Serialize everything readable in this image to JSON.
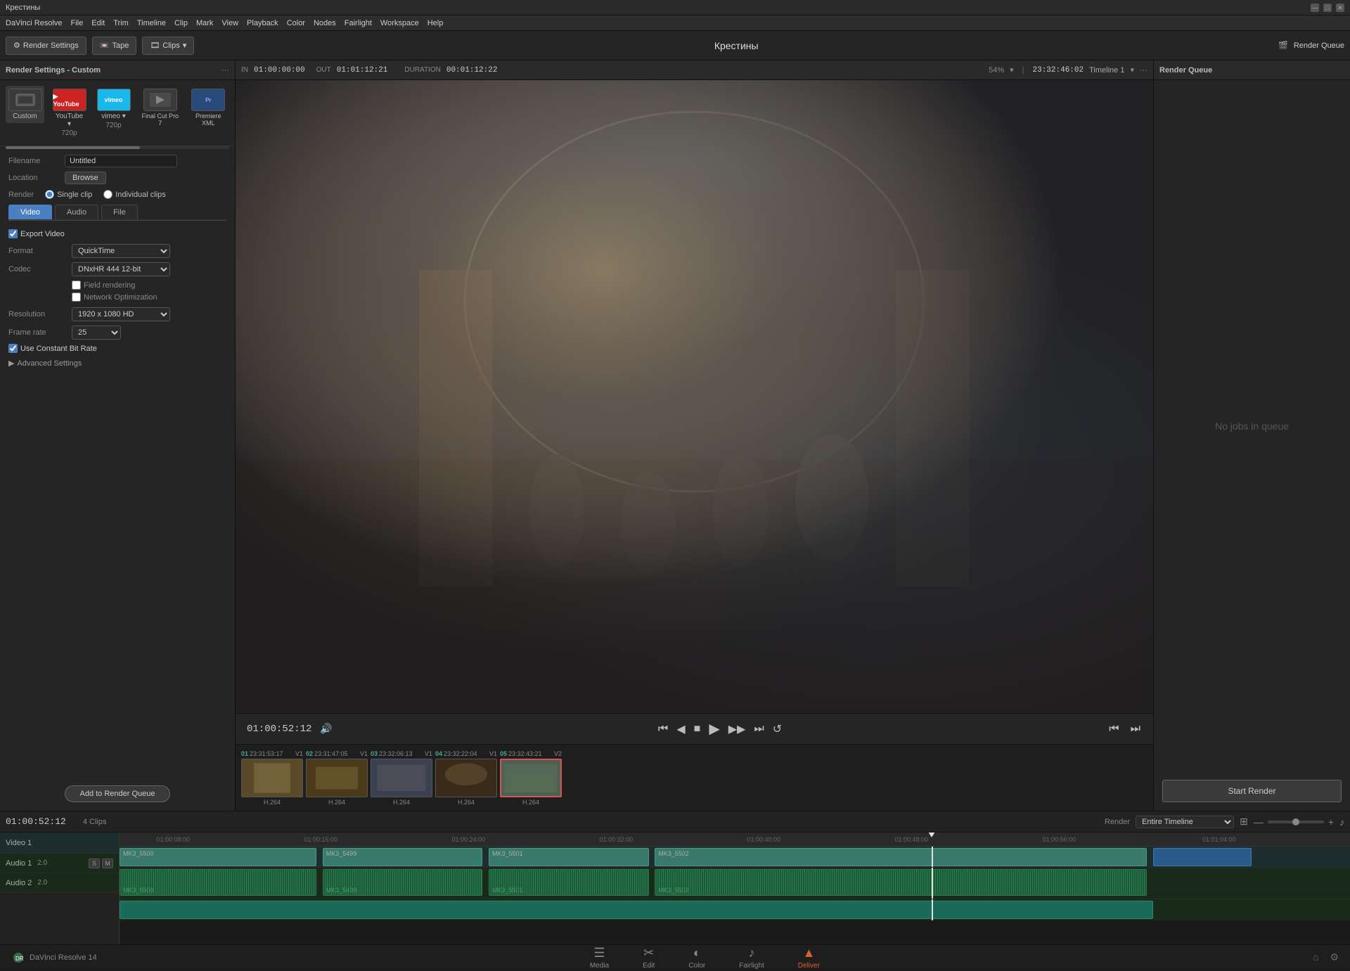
{
  "window": {
    "title": "Крестины",
    "app": "DaVinci Resolve"
  },
  "titlebar": {
    "title": "Крестины",
    "minimize": "—",
    "maximize": "□",
    "close": "✕"
  },
  "menubar": {
    "items": [
      "DaVinci Resolve",
      "File",
      "Edit",
      "Trim",
      "Timeline",
      "Clip",
      "Mark",
      "View",
      "Playback",
      "Color",
      "Nodes",
      "Fairlight",
      "Workspace",
      "Help"
    ]
  },
  "toolbar": {
    "render_settings": "Render Settings",
    "tape": "Tape",
    "clips": "Clips",
    "project_title": "Крестины",
    "render_queue": "Render Queue",
    "chevron": "▾"
  },
  "left_panel": {
    "title": "Render Settings - Custom",
    "more_btn": "···",
    "presets": [
      {
        "id": "custom",
        "label": "Custom",
        "sublabel": ""
      },
      {
        "id": "youtube",
        "label": "YouTube ▾",
        "sublabel": "720p"
      },
      {
        "id": "vimeo",
        "label": "vimeo ▾",
        "sublabel": "720p"
      },
      {
        "id": "finalcut",
        "label": "Final Cut Pro 7",
        "sublabel": ""
      },
      {
        "id": "premiere",
        "label": "Premiere XML",
        "sublabel": ""
      }
    ],
    "filename_label": "Filename",
    "filename_value": "Untitled",
    "location_label": "Location",
    "browse_btn": "Browse",
    "render_label": "Render",
    "single_clip": "Single clip",
    "individual_clips": "Individual clips",
    "tabs": {
      "video": "Video",
      "audio": "Audio",
      "file": "File"
    },
    "export_video": "Export Video",
    "format_label": "Format",
    "format_value": "QuickTime",
    "codec_label": "Codec",
    "codec_value": "DNxHR 444 12-bit",
    "field_rendering": "Field rendering",
    "network_optimization": "Network Optimization",
    "resolution_label": "Resolution",
    "resolution_value": "1920 x 1080 HD",
    "framerate_label": "Frame rate",
    "framerate_value": "25",
    "use_cbr": "Use Constant Bit Rate",
    "advanced_settings": "Advanced Settings",
    "add_to_queue": "Add to Render Queue"
  },
  "preview": {
    "in_label": "IN",
    "in_value": "01:00:00:00",
    "out_label": "OUT",
    "out_value": "01:01:12:21",
    "duration_label": "DURATION",
    "duration_value": "00:01:12:22",
    "timecode": "23:32:46:02",
    "timeline": "Timeline 1",
    "playback_time": "01:00:52:12",
    "zoom": "54%"
  },
  "transport": {
    "go_start": "⏮",
    "prev_frame": "◀",
    "stop": "■",
    "play": "▶",
    "next_frame": "▶",
    "go_end": "⏭",
    "loop": "↺",
    "vol_icon": "🔊",
    "extra_left": "⏮",
    "extra_right": "⏭"
  },
  "filmstrip": {
    "clips": [
      {
        "num": "01",
        "tc": "23:31:53:17",
        "v": "V1",
        "codec": "H.264"
      },
      {
        "num": "02",
        "tc": "23:31:47:05",
        "v": "V1",
        "codec": "H.264"
      },
      {
        "num": "03",
        "tc": "23:32:06:13",
        "v": "V1",
        "codec": "H.264"
      },
      {
        "num": "04",
        "tc": "23:32:22:04",
        "v": "V1",
        "codec": "H.264"
      },
      {
        "num": "05",
        "tc": "23:32:43:21",
        "v": "V2",
        "codec": "H.264",
        "active": true
      }
    ]
  },
  "render_queue": {
    "title": "Render Queue",
    "empty_msg": "No jobs in queue",
    "start_render": "Start Render"
  },
  "timeline": {
    "render_label": "Render",
    "render_option": "Entire Timeline",
    "timecode": "01:00:52:12",
    "clips_count": "4 Clips",
    "tracks": {
      "video": "Video 1",
      "audio1": "Audio 1",
      "audio1_val": "2.0",
      "audio2": "Audio 2",
      "audio2_val": "2.0"
    },
    "ruler_marks": [
      "01:00:08:00",
      "01:00:15:00",
      "01:00:24:00",
      "01:00:32:00",
      "01:00:40:00",
      "01:00:48:00",
      "01:00:56:00",
      "01:01:04:00"
    ],
    "video_clips": [
      {
        "label": "MK3_5500",
        "left": "0%",
        "width": "16%"
      },
      {
        "label": "MK3_5499",
        "left": "16.5%",
        "width": "13%"
      },
      {
        "label": "MK3_5501",
        "left": "30%",
        "width": "13%"
      },
      {
        "label": "MK3_5502",
        "left": "47%",
        "width": "37%"
      },
      {
        "label": "",
        "left": "84.5%",
        "width": "7%"
      }
    ],
    "audio1_clips": [
      {
        "label": "MK3_5500",
        "left": "0%",
        "width": "16%"
      },
      {
        "label": "MK3_5499",
        "left": "16.5%",
        "width": "13%"
      },
      {
        "label": "MK3_5501",
        "left": "30%",
        "width": "13%"
      },
      {
        "label": "MK3_5502",
        "left": "47%",
        "width": "37%"
      }
    ],
    "audio2_clips": [
      {
        "label": "",
        "left": "0%",
        "width": "84.5%"
      }
    ]
  },
  "statusbar": {
    "app_name": "DaVinci Resolve 14",
    "nav_items": [
      {
        "id": "media",
        "icon": "☰",
        "label": "Media"
      },
      {
        "id": "edit",
        "icon": "✂",
        "label": "Edit"
      },
      {
        "id": "color",
        "icon": "◐",
        "label": "Color"
      },
      {
        "id": "fairlight",
        "icon": "♪",
        "label": "Fairlight"
      },
      {
        "id": "deliver",
        "icon": "▲",
        "label": "Deliver",
        "active": true
      }
    ]
  }
}
